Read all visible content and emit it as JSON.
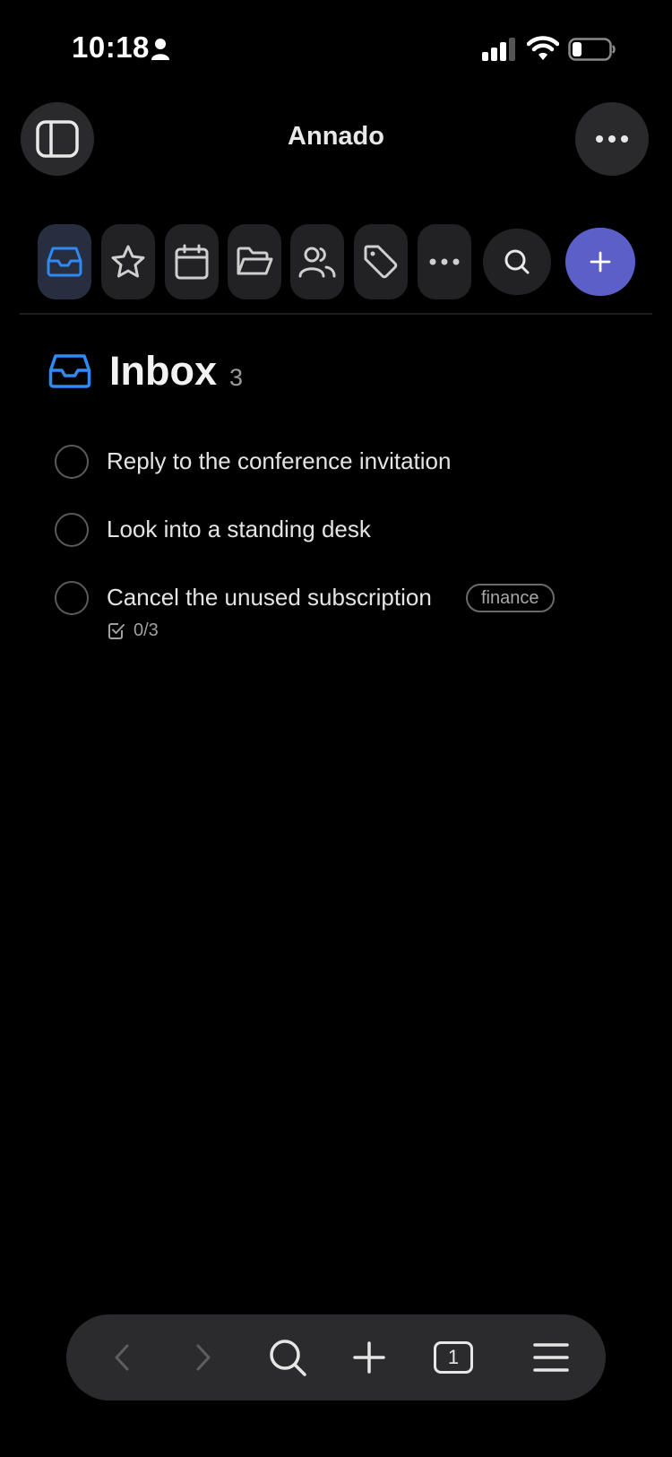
{
  "status_bar": {
    "time": "10:18"
  },
  "header": {
    "title": "Annado"
  },
  "toolbar": {
    "items": [
      {
        "icon": "inbox-icon",
        "active": true
      },
      {
        "icon": "star-icon"
      },
      {
        "icon": "calendar-icon"
      },
      {
        "icon": "folder-icon"
      },
      {
        "icon": "people-icon"
      },
      {
        "icon": "tag-icon"
      },
      {
        "icon": "ellipsis-icon"
      }
    ],
    "search_icon": "search-icon",
    "add_icon": "plus-icon"
  },
  "colors": {
    "accent": "#5b5fc7",
    "inbox_blue": "#2f8af5",
    "background": "#000000"
  },
  "page": {
    "title": "Inbox",
    "count": "3"
  },
  "tasks": [
    {
      "title": "Reply to the conference invitation"
    },
    {
      "title": "Look into a standing desk"
    },
    {
      "title": "Cancel the unused subscription",
      "tag": "finance",
      "subtasks": "0/3"
    }
  ],
  "browser_bar": {
    "tab_count": "1"
  }
}
